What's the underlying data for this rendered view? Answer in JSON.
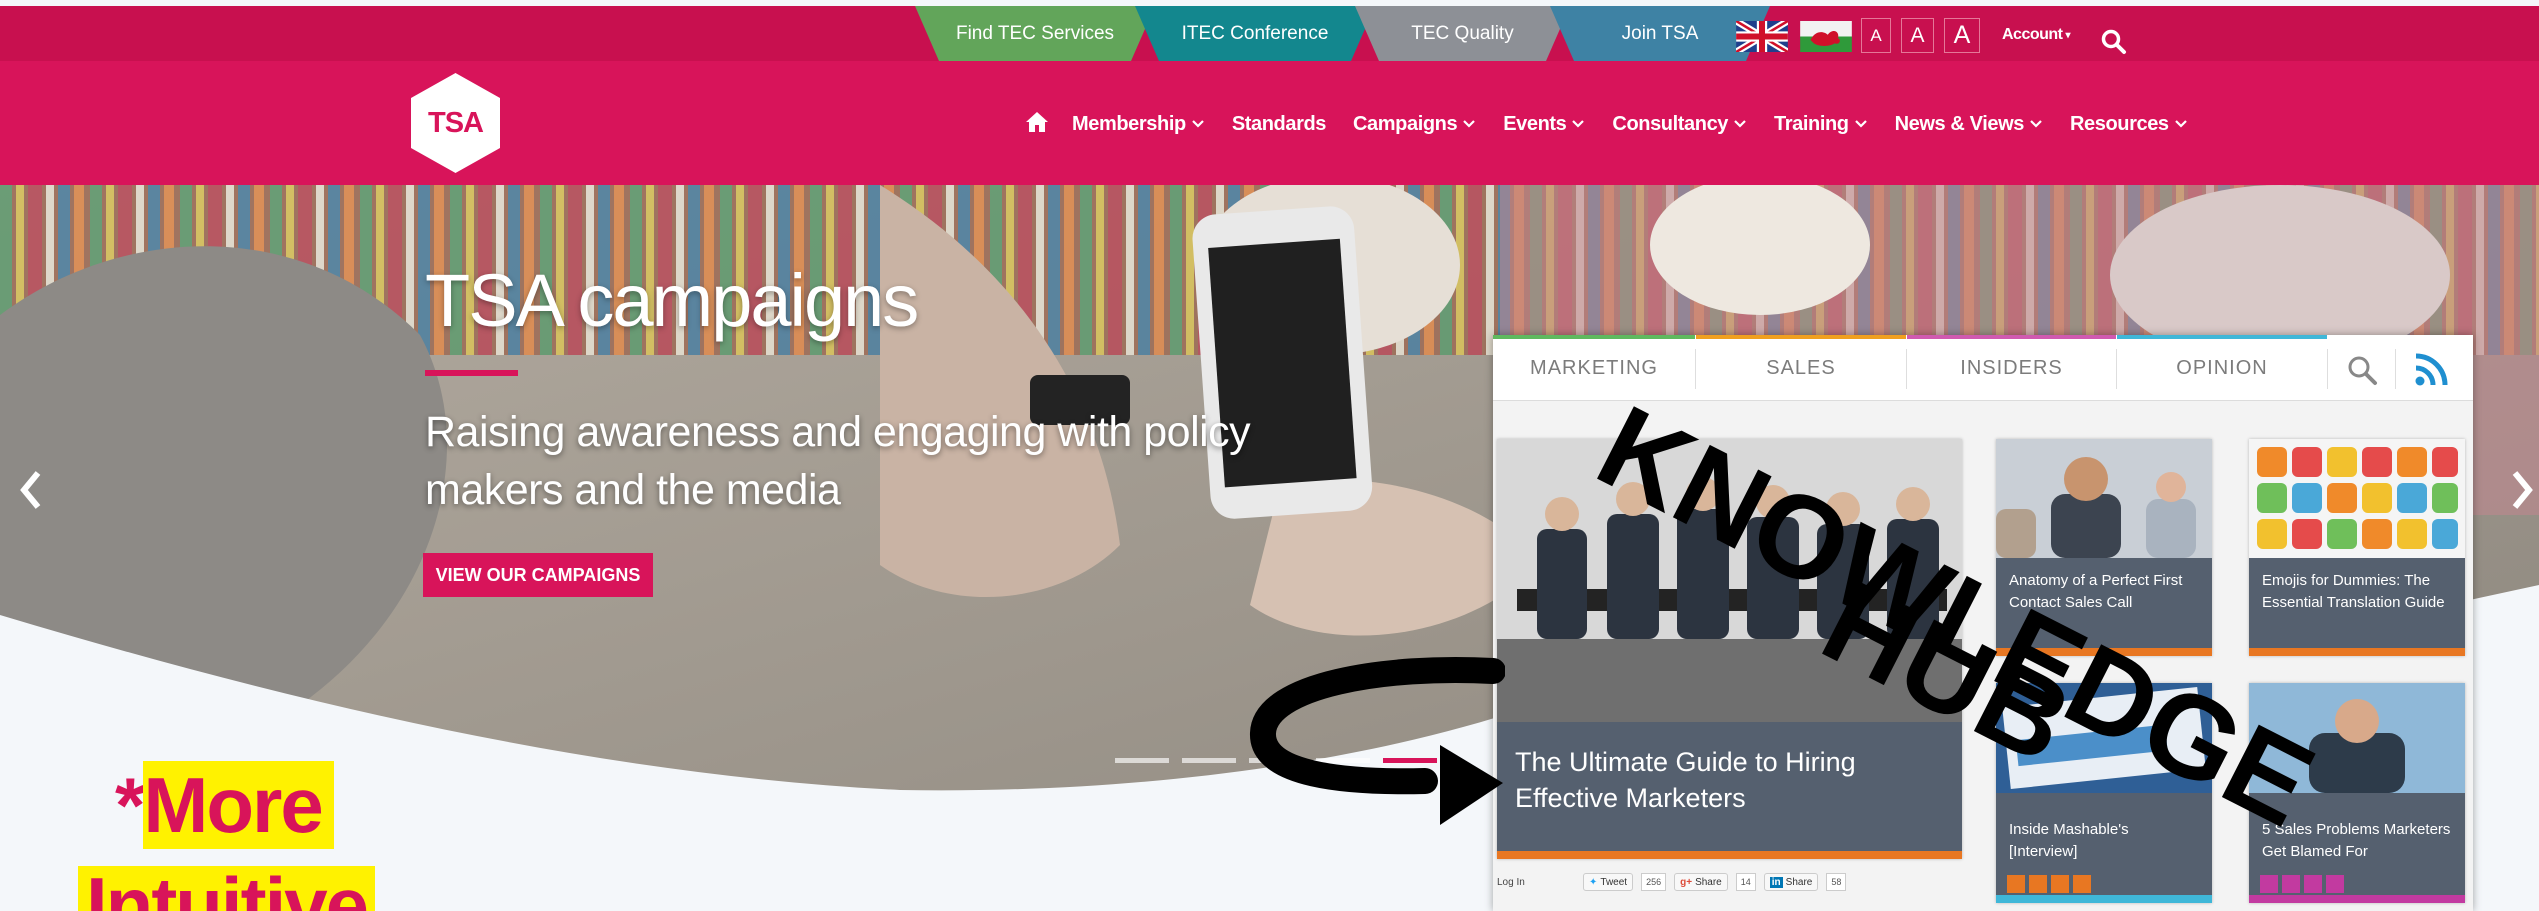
{
  "utility": {
    "tabs": [
      {
        "label": "Find TEC Services",
        "color": "#62a55a"
      },
      {
        "label": "ITEC Conference",
        "color": "#13878e"
      },
      {
        "label": "TEC Quality",
        "color": "#8d9096"
      },
      {
        "label": "Join TSA",
        "color": "#3e82a4"
      }
    ],
    "font_sizes": [
      "A",
      "A",
      "A"
    ],
    "account_label": "Account"
  },
  "logo": {
    "text": "TSA"
  },
  "nav": {
    "items": [
      {
        "label": "Membership",
        "dropdown": true
      },
      {
        "label": "Standards",
        "dropdown": false
      },
      {
        "label": "Campaigns",
        "dropdown": true
      },
      {
        "label": "Events",
        "dropdown": true
      },
      {
        "label": "Consultancy",
        "dropdown": true
      },
      {
        "label": "Training",
        "dropdown": true
      },
      {
        "label": "News & Views",
        "dropdown": true
      },
      {
        "label": "Resources",
        "dropdown": true
      }
    ]
  },
  "hero": {
    "title": "TSA campaigns",
    "subtitle": "Raising awareness and engaging with policy makers and the media",
    "button_label": "VIEW OUR CAMPAIGNS",
    "active_slide": 5,
    "slide_count": 5
  },
  "annotation": {
    "line1_star": "*",
    "line1": "More",
    "line2": "Intuitive",
    "overlay_line1": "KNOWLEDGE",
    "overlay_line2": "HUB"
  },
  "knowledge_hub": {
    "tabs": [
      {
        "label": "MARKETING",
        "color": "#5fb95f"
      },
      {
        "label": "SALES",
        "color": "#f0a020"
      },
      {
        "label": "INSIDERS",
        "color": "#d05ab0"
      },
      {
        "label": "OPINION",
        "color": "#3fb7d8"
      }
    ],
    "feature": {
      "title": "The Ultimate Guide to Hiring Effective Marketers",
      "login": "Log In",
      "tweet_label": "Tweet",
      "tweet_count": "256",
      "gplus_label": "Share",
      "gplus_count": "14",
      "linkedin_label": "Share",
      "linkedin_count": "58"
    },
    "cards": [
      {
        "title": "Anatomy of a Perfect First Contact Sales Call"
      },
      {
        "title": "Emojis for Dummies: The Essential Translation Guide"
      },
      {
        "title": "Inside Mashable's [Interview]"
      },
      {
        "title": "5 Sales Problems Marketers Get Blamed For"
      }
    ]
  },
  "colors": {
    "brand": "#d8145a",
    "topbar": "#c8104f",
    "highlight": "#fff200",
    "card_caption": "#55606f"
  }
}
